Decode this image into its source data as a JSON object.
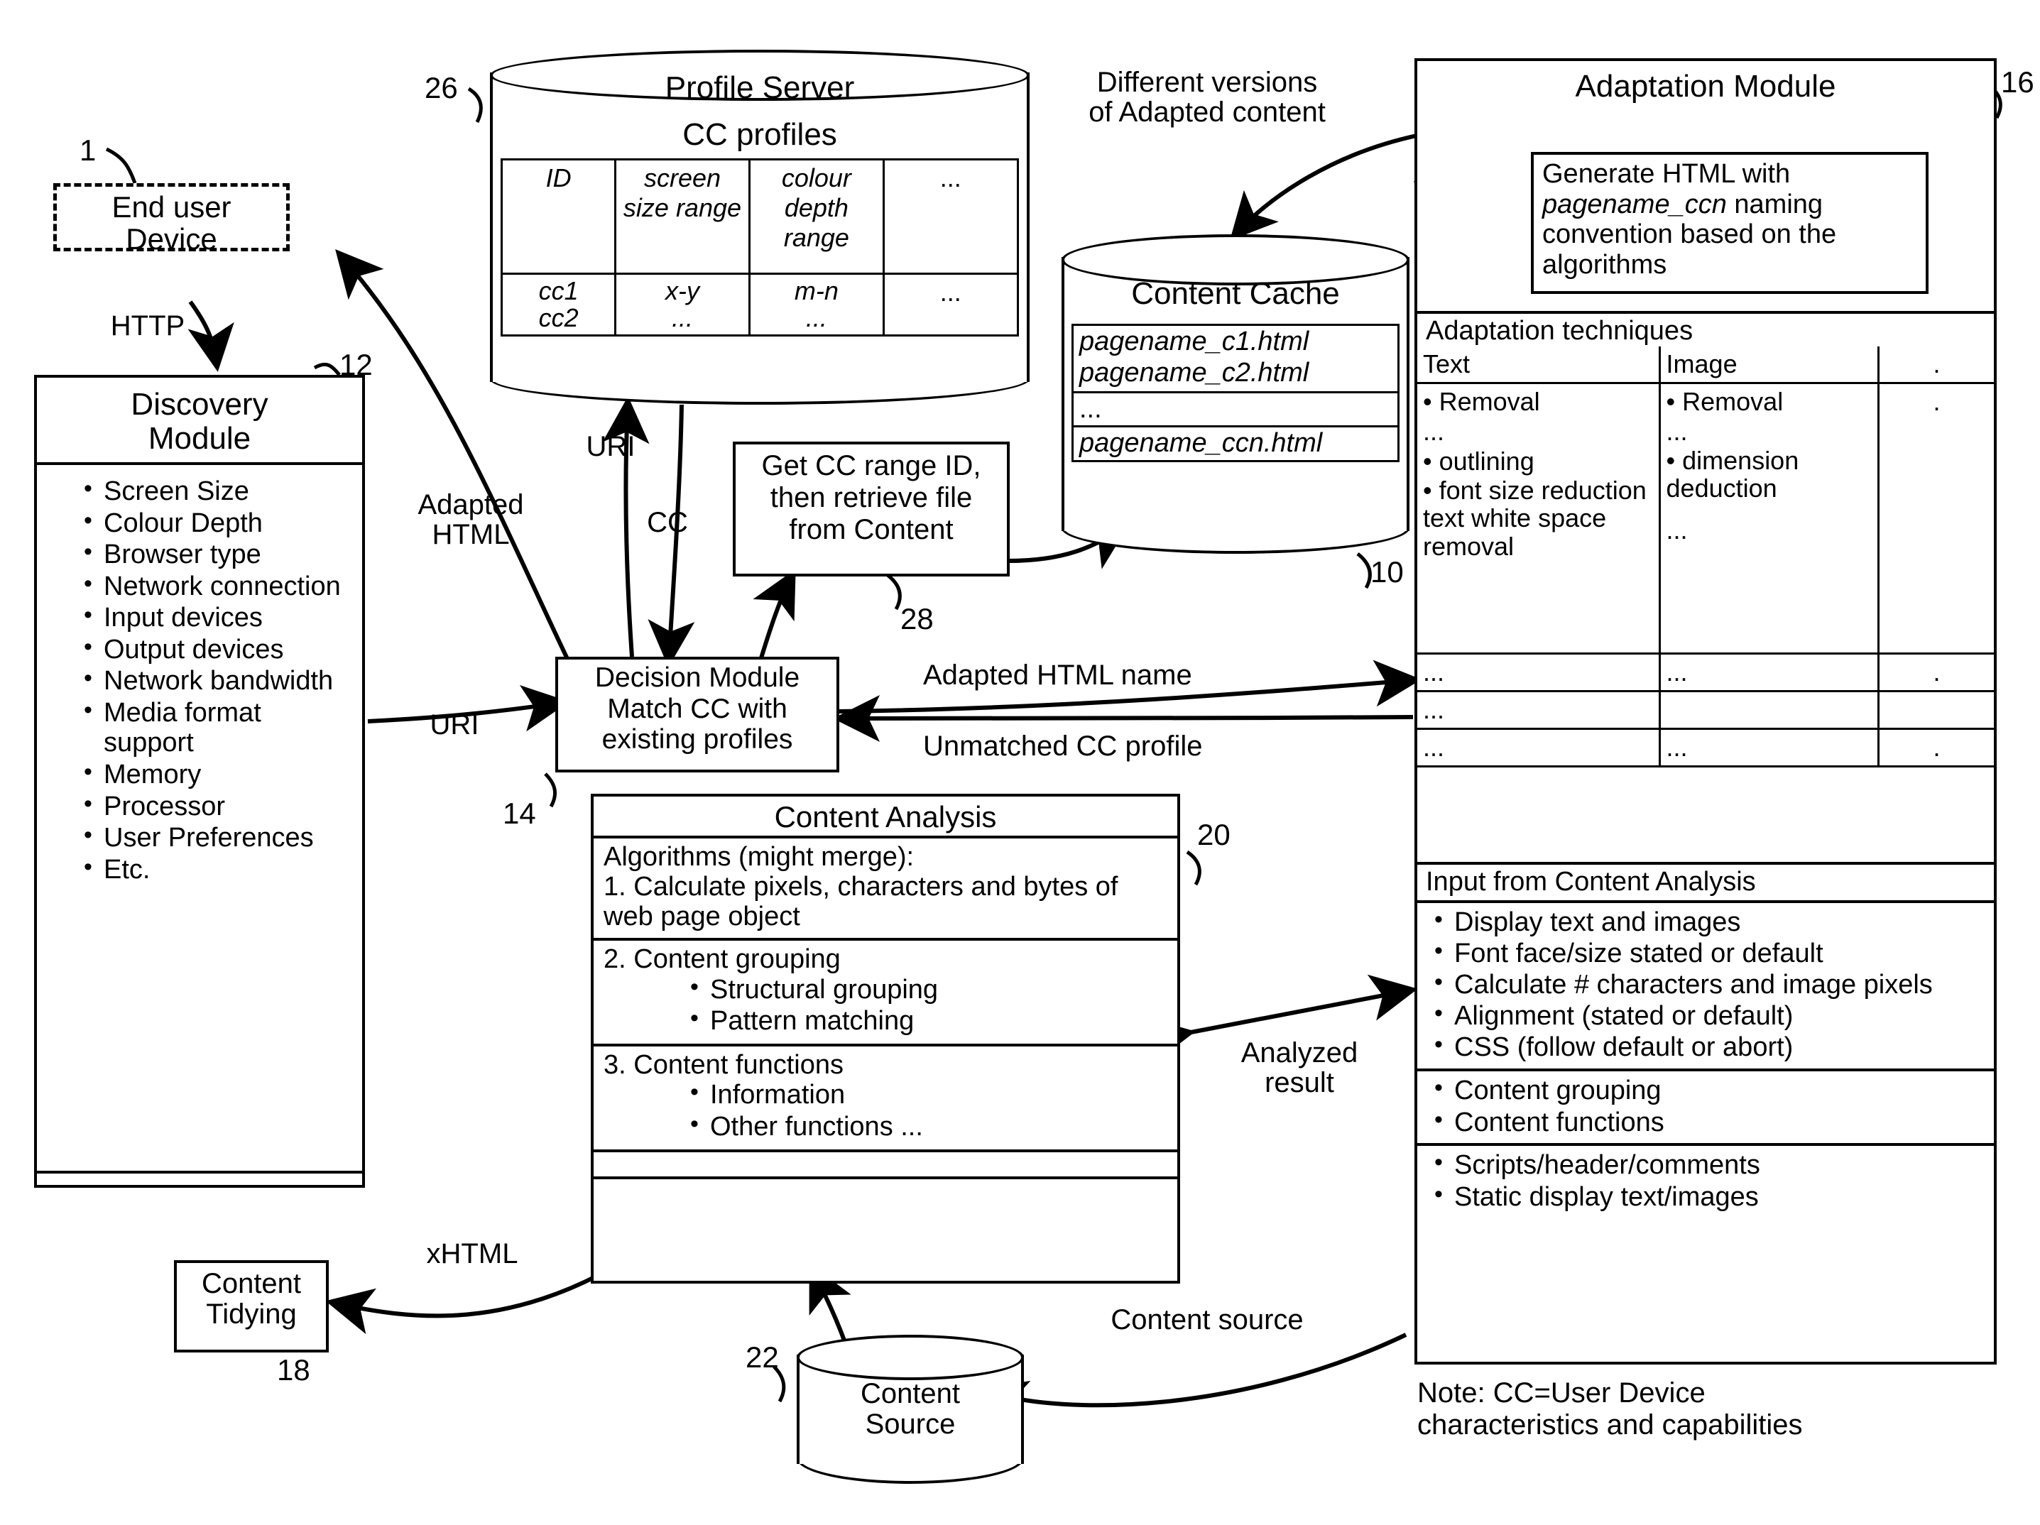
{
  "end_user_device": {
    "label": "End user\nDevice",
    "ref": "1"
  },
  "http_label": "HTTP",
  "discovery_module": {
    "title": "Discovery\nModule",
    "ref": "12",
    "items": [
      "Screen Size",
      "Colour Depth",
      "Browser type",
      "Network connection",
      "Input devices",
      "Output devices",
      "Network bandwidth",
      "Media format support",
      "Memory",
      "Processor",
      "User Preferences",
      "Etc."
    ]
  },
  "profile_server": {
    "title": "Profile Server",
    "subtitle": "CC profiles",
    "ref": "26",
    "headers": [
      "ID",
      "screen size range",
      "colour depth range",
      "..."
    ],
    "rows": [
      [
        "cc1",
        "x-y",
        "m-n",
        "..."
      ],
      [
        "cc2",
        "...",
        "...",
        ""
      ]
    ]
  },
  "content_cache": {
    "title": "Content Cache",
    "ref": "10",
    "caption": "Different versions\nof Adapted content",
    "entries": [
      "pagename_c1.html",
      "pagename_c2.html",
      "...",
      "pagename_ccn.html"
    ]
  },
  "get_cc_box": {
    "text": "Get CC range ID,\nthen retrieve file\nfrom Content",
    "ref": "28"
  },
  "decision_module": {
    "text": "Decision Module\nMatch CC with\nexisting profiles",
    "ref": "14"
  },
  "content_analysis": {
    "title": "Content Analysis",
    "ref": "20",
    "algorithms_header": "Algorithms (might merge):",
    "step1": "1. Calculate pixels, characters and bytes of web page object",
    "step2": "2. Content grouping",
    "step2_items": [
      "Structural grouping",
      "Pattern matching"
    ],
    "step3": "3. Content functions",
    "step3_items": [
      "Information",
      "Other functions ..."
    ]
  },
  "adaptation_module": {
    "title": "Adaptation Module",
    "ref": "16",
    "generate_box": "Generate HTML with pagename_ccn naming convention based on the algorithms",
    "generate_box_pre": "Generate HTML with ",
    "generate_box_ital": "pagename_ccn",
    "generate_box_post": " naming convention based on the algorithms",
    "techniques_title": "Adaptation techniques",
    "techniques_headers": [
      "Text",
      "Image",
      "."
    ],
    "techniques_text_items": [
      "• Removal",
      "...",
      "• outlining",
      "• font size reduction text white space removal"
    ],
    "techniques_image_items": [
      "• Removal",
      "...",
      "• dimension deduction",
      "..."
    ],
    "techniques_filler_rows": [
      [
        "...",
        "...",
        "."
      ],
      [
        "...",
        "",
        ""
      ],
      [
        "...",
        "...",
        "."
      ]
    ],
    "input_title": "Input from Content Analysis",
    "input_group1": [
      "Display text and images",
      "Font face/size stated or default",
      "Calculate # characters and image pixels",
      "Alignment (stated or default)",
      "CSS (follow default or abort)"
    ],
    "input_group2": [
      "Content grouping",
      "Content functions"
    ],
    "input_group3": [
      "Scripts/header/comments",
      "Static display text/images"
    ]
  },
  "content_tidying": {
    "label": "Content\nTidying",
    "ref": "18"
  },
  "content_source": {
    "label": "Content\nSource",
    "ref": "22"
  },
  "arrow_labels": {
    "adapted_html": "Adapted\nHTML",
    "uri_top": "URI",
    "uri_bottom": "URI",
    "cc": "CC",
    "adapted_html_name": "Adapted HTML name",
    "unmatched_cc_profile": "Unmatched CC profile",
    "analyzed_result": "Analyzed\nresult",
    "xhtml": "xHTML",
    "content_source_flow": "Content source"
  },
  "note": "Note: CC=User Device\ncharacteristics and capabilities"
}
